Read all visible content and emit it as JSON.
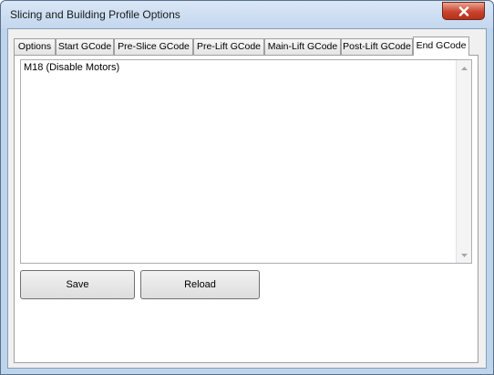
{
  "window": {
    "title": "Slicing and Building Profile Options",
    "close_icon": "close-x-icon"
  },
  "tabs": [
    {
      "label": "Options",
      "active": false
    },
    {
      "label": "Start GCode",
      "active": false
    },
    {
      "label": "Pre-Slice GCode",
      "active": false
    },
    {
      "label": "Pre-Lift GCode",
      "active": false
    },
    {
      "label": "Main-Lift GCode",
      "active": false
    },
    {
      "label": "Post-Lift GCode",
      "active": false
    },
    {
      "label": "End GCode",
      "active": true
    }
  ],
  "editor": {
    "content": "M18 (Disable Motors)"
  },
  "buttons": {
    "save_label": "Save",
    "reload_label": "Reload"
  },
  "colors": {
    "close_button": "#c8442d",
    "window_frame": "#bcd4ec"
  }
}
